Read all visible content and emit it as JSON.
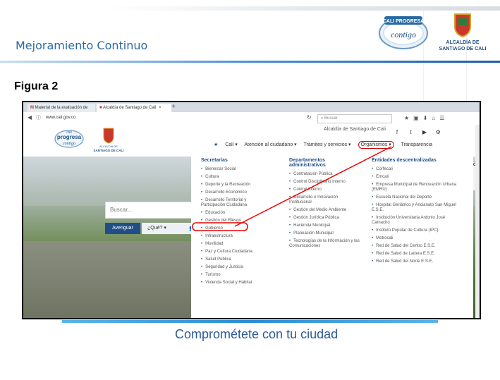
{
  "header": {
    "title": "Mejoramiento Continuo",
    "logo_cali_line1": "CALI PROGRESA",
    "logo_cali_line2": "contigo",
    "logo_alcaldia_line1": "ALCALDÍA DE",
    "logo_alcaldia_line2": "SANTIAGO DE CALI"
  },
  "figure_label": "Figura 2",
  "browser": {
    "tab1_label": "Material de la evaluación de",
    "tab2_label": "Alcaldía de Santiago de Cali",
    "tab_close": "×",
    "new_tab": "+",
    "url": "www.cali.gov.co",
    "search_placeholder": "Buscar"
  },
  "site": {
    "logo_line1": "cali",
    "logo_line2": "progresa",
    "logo_line3": "contigo",
    "logo2_line1": "ALCALDÍA DE",
    "logo2_line2": "SANTIAGO DE CALI",
    "alcaldia_label": "Alcaldía de Santiago de Cali",
    "nav": {
      "home_icon": "★",
      "cali": "Cali ▾",
      "atencion": "Atención al ciudadano ▾",
      "tramites": "Trámites y servicios ▾",
      "organismos": "Organismos ▾",
      "transparencia": "Transparencia"
    },
    "search": {
      "placeholder": "Buscar...",
      "button": "Averiguar",
      "que": "¿Qué? ▾"
    },
    "side_text": "ón"
  },
  "mega_menu": {
    "col1": {
      "heading": "Secretarías",
      "items": [
        "Bienestar Social",
        "Cultura",
        "Deporte y la Recreación",
        "Desarrollo Económico",
        "Desarrollo Territorial y Participación Ciudadana",
        "Educación",
        "Gestión del Riesgo",
        "Gobierno",
        "Infraestructura",
        "Movilidad",
        "Paz y Cultura Ciudadana",
        "Salud Pública",
        "Seguridad y Justicia",
        "Turismo",
        "Vivienda Social y Hábitat"
      ]
    },
    "col2": {
      "heading": "Departamentos administrativos",
      "items": [
        "Contratación Pública",
        "Control Disciplinario Interno",
        "Control Interno",
        "Desarrollo e Innovación Institucional",
        "Gestión del Medio Ambiente",
        "Gestión Jurídica Pública",
        "Hacienda Municipal",
        "Planeación Municipal",
        "Tecnologías de la Información y las Comunicaciones"
      ]
    },
    "col3": {
      "heading": "Entidades descentralizadas",
      "items": [
        "Corfecali",
        "Emcali",
        "Empresa Municipal de Renovación Urbana (EMRU)",
        "Escuela Nacional del Deporte",
        "Hospital Geriátrico y Ancianato San Miguel E.S.E.",
        "Institución Universitaria Antonio José Camacho",
        "Instituto Popular de Cultura (IPC)",
        "Metrocali",
        "Red de Salud del Centro E.S.E.",
        "Red de Salud de Ladera E.S.E.",
        "Red de Salud del Norte E.S.E."
      ]
    }
  },
  "slogan": "Comprométete con tu ciudad",
  "colors": {
    "accent_blue": "#1f4f86",
    "title_blue": "#2a6aa3",
    "highlight_red": "#e00000"
  }
}
